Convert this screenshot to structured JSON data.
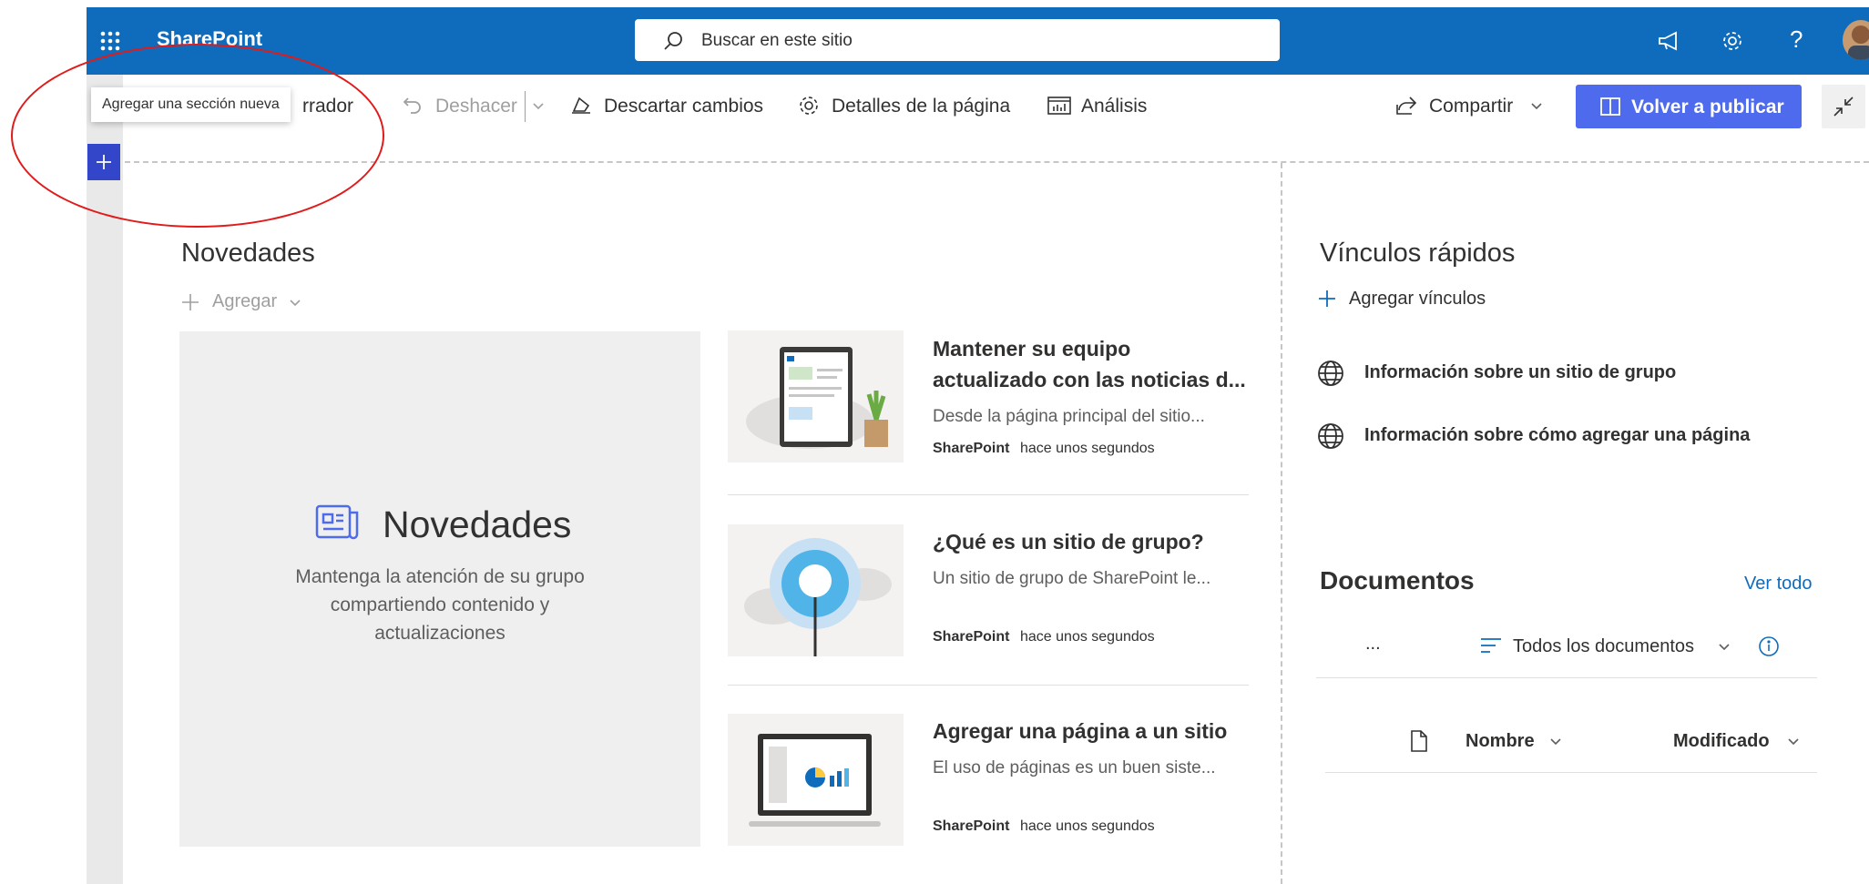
{
  "app": {
    "name": "SharePoint"
  },
  "search": {
    "placeholder": "Buscar en este sitio"
  },
  "toolbar": {
    "tooltip": "Agregar una sección nueva",
    "draft_fragment": "rrador",
    "undo": "Deshacer",
    "discard": "Descartar cambios",
    "page_details": "Detalles de la página",
    "analytics": "Análisis",
    "share": "Compartir",
    "republish": "Volver a publicar"
  },
  "news": {
    "heading": "Novedades",
    "add": "Agregar",
    "hero_title": "Novedades",
    "hero_subtitle_lines": [
      "Mantenga la atención de su grupo",
      "compartiendo contenido y",
      "actualizaciones"
    ],
    "items": [
      {
        "title_lines": [
          "Mantener su equipo",
          "actualizado con las noticias d..."
        ],
        "desc": "Desde la página principal del sitio...",
        "author": "SharePoint",
        "time": "hace unos segundos"
      },
      {
        "title_lines": [
          "¿Qué es un sitio de grupo?"
        ],
        "desc": "Un sitio de grupo de SharePoint le...",
        "author": "SharePoint",
        "time": "hace unos segundos"
      },
      {
        "title_lines": [
          "Agregar una página a un sitio"
        ],
        "desc": "El uso de páginas es un buen siste...",
        "author": "SharePoint",
        "time": "hace unos segundos"
      }
    ]
  },
  "quick_links": {
    "heading": "Vínculos rápidos",
    "add": "Agregar vínculos",
    "items": [
      {
        "label": "Información sobre un sitio de grupo",
        "icon": "globe-icon"
      },
      {
        "label": "Información sobre cómo agregar una página",
        "icon": "globe-icon"
      }
    ]
  },
  "documents": {
    "heading": "Documentos",
    "see_all": "Ver todo",
    "more": "...",
    "view": "Todos los documentos",
    "columns": [
      "Nombre",
      "Modificado"
    ]
  },
  "colors": {
    "suite_bar": "#0f6cbd",
    "publish": "#4f6bed",
    "section_add": "#3346c9",
    "annotation": "#e11a1a"
  }
}
